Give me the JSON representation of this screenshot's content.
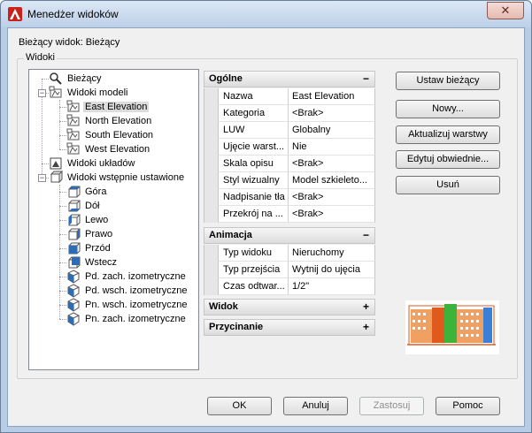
{
  "window": {
    "title": "Menedżer widoków",
    "close_label": "✕"
  },
  "current_view": "Bieżący widok: Bieżący",
  "group_label": "Widoki",
  "tree": {
    "items": [
      {
        "label": "Bieżący",
        "icon": "magnifier-icon"
      },
      {
        "label": "Widoki modeli",
        "icon": "model-views-icon"
      },
      {
        "label": "East Elevation",
        "icon": "camera-view-icon"
      },
      {
        "label": "North Elevation",
        "icon": "camera-view-icon"
      },
      {
        "label": "South Elevation",
        "icon": "camera-view-icon"
      },
      {
        "label": "West Elevation",
        "icon": "camera-view-icon"
      },
      {
        "label": "Widoki układów",
        "icon": "layout-views-icon"
      },
      {
        "label": "Widoki wstępnie ustawione",
        "icon": "preset-views-icon"
      },
      {
        "label": "Góra",
        "icon": "cube-top-icon"
      },
      {
        "label": "Dół",
        "icon": "cube-bottom-icon"
      },
      {
        "label": "Lewo",
        "icon": "cube-left-icon"
      },
      {
        "label": "Prawo",
        "icon": "cube-right-icon"
      },
      {
        "label": "Przód",
        "icon": "cube-front-icon"
      },
      {
        "label": "Wstecz",
        "icon": "cube-back-icon"
      },
      {
        "label": "Pd. zach. izometryczne",
        "icon": "iso-cube-icon"
      },
      {
        "label": "Pd. wsch. izometryczne",
        "icon": "iso-cube-icon"
      },
      {
        "label": "Pn. wsch. izometryczne",
        "icon": "iso-cube-icon"
      },
      {
        "label": "Pn. zach. izometryczne",
        "icon": "iso-cube-icon"
      }
    ]
  },
  "properties": {
    "general": {
      "title": "Ogólne",
      "toggle": "−",
      "rows": [
        {
          "name": "Nazwa",
          "value": "East Elevation"
        },
        {
          "name": "Kategoria",
          "value": "<Brak>"
        },
        {
          "name": "LUW",
          "value": "Globalny"
        },
        {
          "name": "Ujęcie warst...",
          "value": "Nie"
        },
        {
          "name": "Skala opisu",
          "value": "<Brak>"
        },
        {
          "name": "Styl wizualny",
          "value": "Model szkieleto..."
        },
        {
          "name": "Nadpisanie tła",
          "value": "<Brak>"
        },
        {
          "name": "Przekrój na ...",
          "value": "<Brak>"
        }
      ]
    },
    "animation": {
      "title": "Animacja",
      "toggle": "−",
      "rows": [
        {
          "name": "Typ widoku",
          "value": "Nieruchomy"
        },
        {
          "name": "Typ przejścia",
          "value": "Wytnij do ujęcia"
        },
        {
          "name": "Czas odtwar...",
          "value": "1/2\""
        }
      ]
    },
    "view": {
      "title": "Widok",
      "toggle": "+"
    },
    "clipping": {
      "title": "Przycinanie",
      "toggle": "+"
    }
  },
  "buttons": {
    "set_current": "Ustaw bieżący",
    "new": "Nowy...",
    "update_layers": "Aktualizuj warstwy",
    "edit_boundaries": "Edytuj obwiednie...",
    "delete": "Usuń",
    "ok": "OK",
    "cancel": "Anuluj",
    "apply": "Zastosuj",
    "help": "Pomoc"
  },
  "colors": {
    "accent": "#e05a1e",
    "preview_blue": "#3b7fd6",
    "preview_green": "#3cb43c"
  }
}
